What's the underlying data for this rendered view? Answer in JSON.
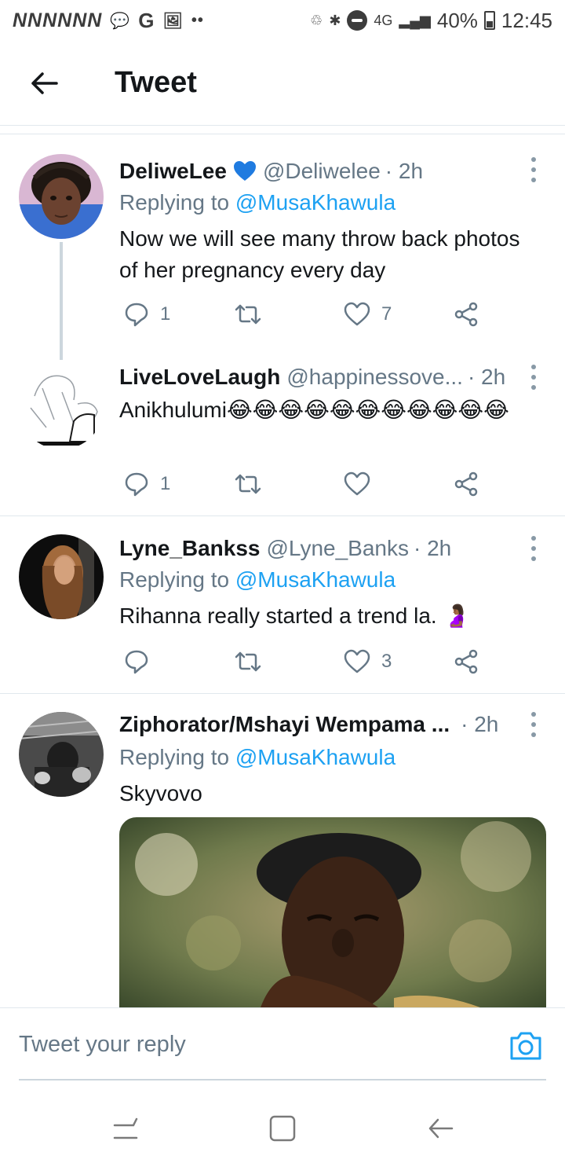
{
  "status_bar": {
    "left_letters": "NNNNNN",
    "g_letter": "G",
    "network": "4G",
    "battery": "40%",
    "time": "12:45"
  },
  "header": {
    "back_icon": "arrow-left-icon",
    "title": "Tweet"
  },
  "tweets": [
    {
      "name": "DeliweLee",
      "verified_emoji": "blue-heart",
      "handle": "@Deliwelee",
      "time": "· 2h",
      "replying_prefix": "Replying to ",
      "replying_to": "@MusaKhawula",
      "text": "Now we will see many throw back photos of her pregnancy every day",
      "replies": "1",
      "retweets": "",
      "likes": "7"
    },
    {
      "name": "LiveLoveLaugh",
      "handle": "@happinessove...",
      "time": "· 2h",
      "text": "Anikhulumi😂😂😂😂😂😂😂😂😂😂😂",
      "replies": "1",
      "retweets": "",
      "likes": ""
    },
    {
      "name": "Lyne_Bankss",
      "handle": "@Lyne_Banks",
      "time": "· 2h",
      "replying_prefix": "Replying to ",
      "replying_to": "@MusaKhawula",
      "text": "Rihanna really started a trend la. 🤰🏾",
      "replies": "",
      "retweets": "",
      "likes": "3"
    },
    {
      "name": "Ziphorator/Mshayi Wempama ...",
      "handle": "",
      "time": "· 2h",
      "replying_prefix": "Replying to ",
      "replying_to": "@MusaKhawula",
      "text": "Skyvovo"
    }
  ],
  "reply_bar": {
    "placeholder": "Tweet your reply",
    "camera_icon": "camera-icon"
  },
  "colors": {
    "accent": "#1da1f2",
    "muted": "#657786",
    "divider": "#e1e8ed",
    "thread_line": "#ccd6dd"
  }
}
